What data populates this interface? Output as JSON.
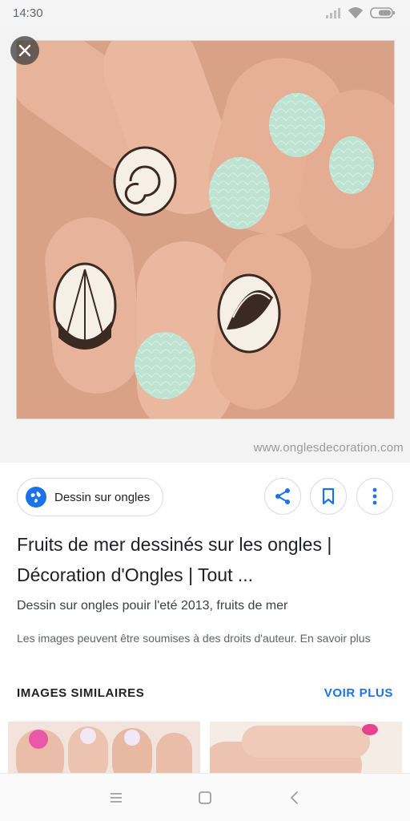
{
  "status_bar": {
    "time": "14:30",
    "icons": [
      "signal-icon",
      "wifi-icon",
      "battery-icon"
    ]
  },
  "viewer": {
    "watermark": "www.onglesdecoration.com",
    "close_icon": "close-icon"
  },
  "source": {
    "site_name": "Dessin sur ongles",
    "icon": "globe-icon"
  },
  "actions": {
    "share_icon": "share-icon",
    "save_icon": "bookmark-icon",
    "more_icon": "more-vertical-icon"
  },
  "result": {
    "title": "Fruits de mer dessinés sur les ongles | Décoration d'Ongles | Tout ...",
    "description": "Dessin sur ongles pouir l'eté 2013, fruits de mer",
    "copyright": "Les images peuvent être soumises à des droits d'auteur. En savoir plus"
  },
  "similar": {
    "title": "IMAGES SIMILAIRES",
    "see_more": "VOIR PLUS"
  },
  "nav_bar": {
    "icons": [
      "menu-icon",
      "home-square-icon",
      "back-icon"
    ]
  },
  "colors": {
    "accent": "#1a73e8",
    "text": "#202124",
    "secondary_text": "#5f6368",
    "nail_mint": "#bfe3d3",
    "skin": "#e8b49c"
  }
}
